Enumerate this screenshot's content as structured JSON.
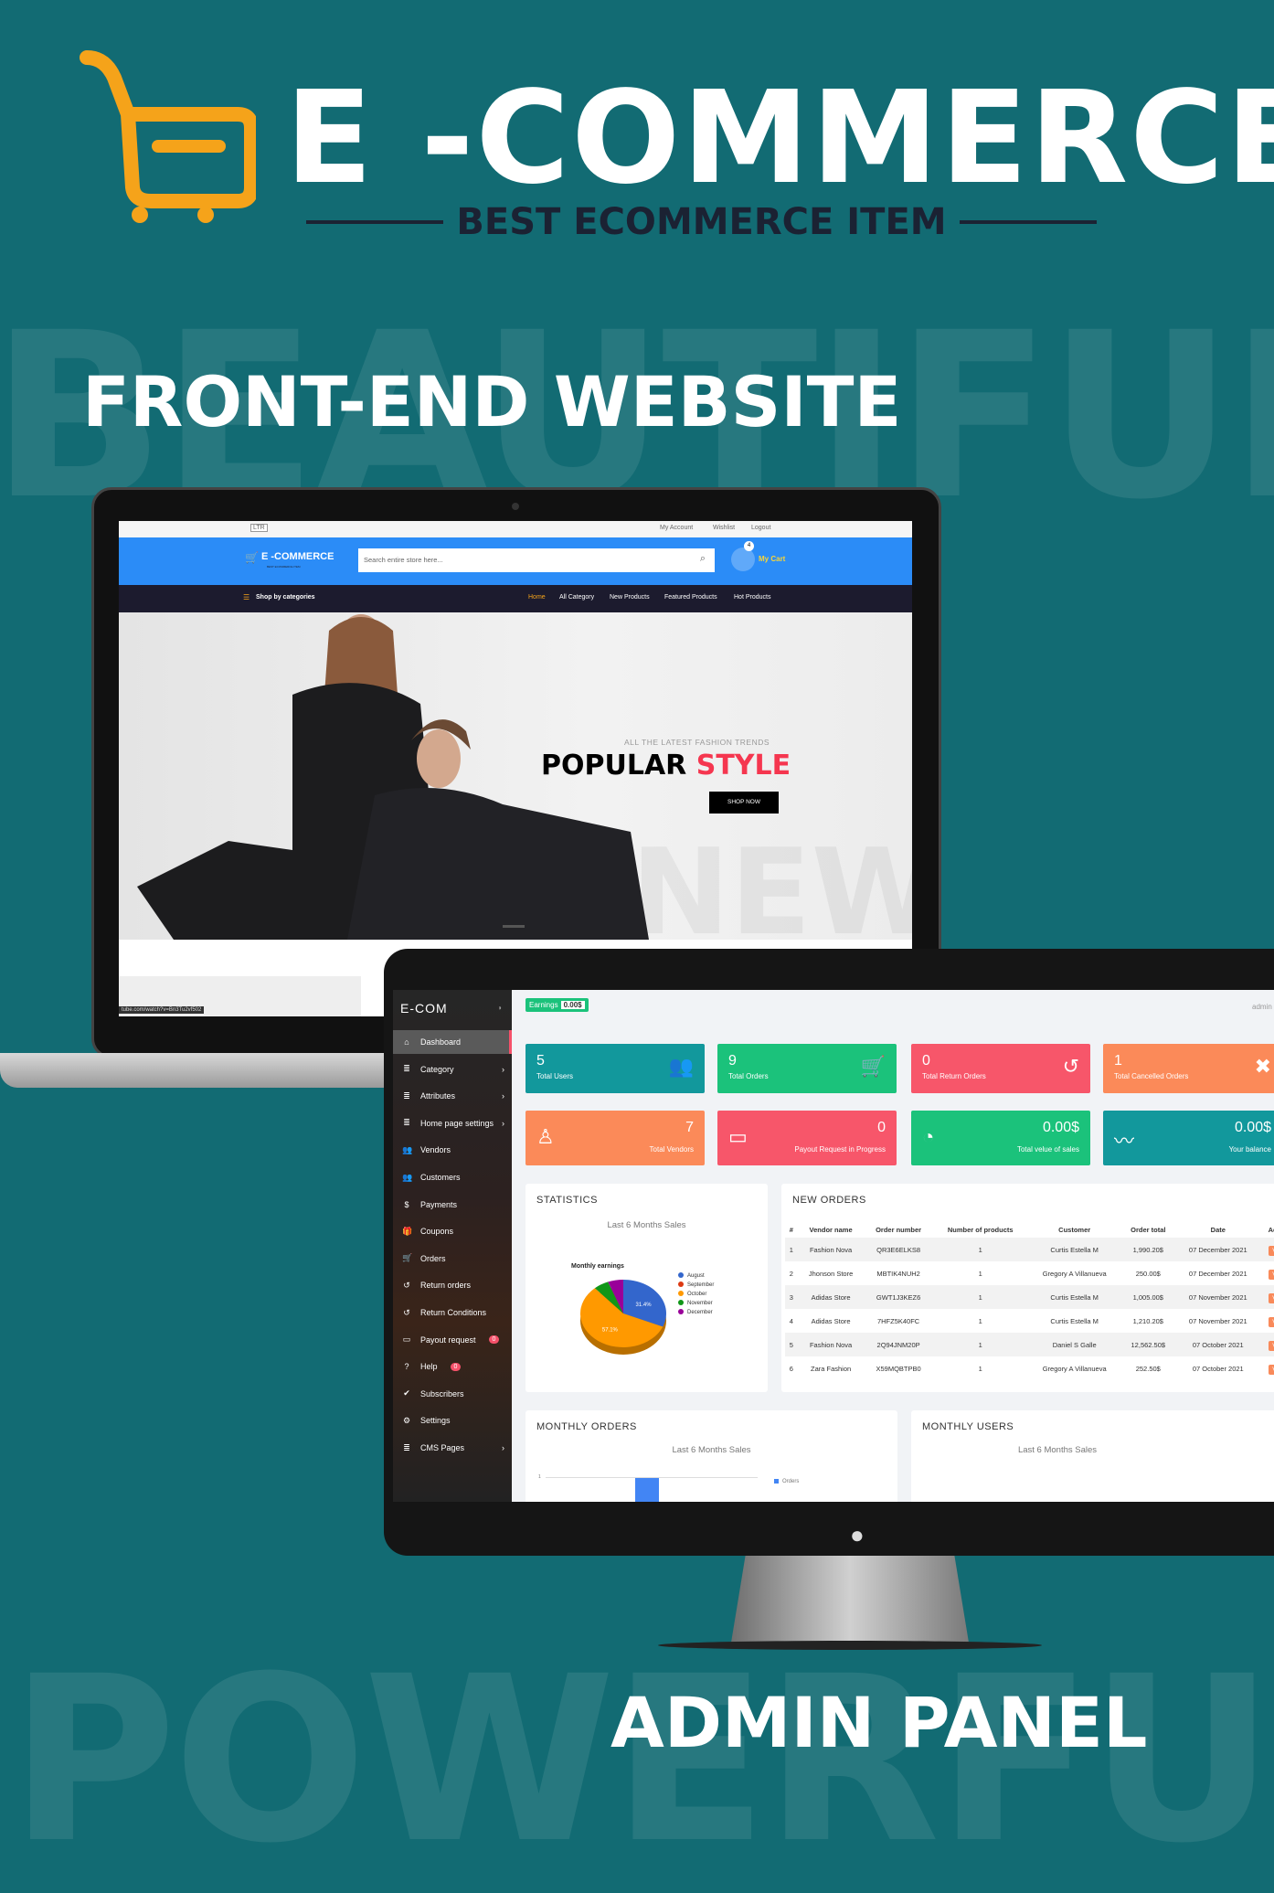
{
  "banner": {
    "title": "E -COMMERCE",
    "subtitle": "BEST ECOMMERCE ITEM",
    "watermark_top": "BEAUTIFUL",
    "watermark_bottom": "POWERFUL",
    "front_heading": "FRONT-END WEBSITE",
    "admin_heading": "ADMIN PANEL",
    "colors": {
      "background": "#126b73",
      "logo": "#f5a31a",
      "subtitle": "#1b2233"
    }
  },
  "storefront": {
    "direction_select": "LTR",
    "top_links": [
      "My Account",
      "Wishlist",
      "Logout"
    ],
    "logo_text": "E -COMMERCE",
    "logo_sub": "BEST ECOMMERCE ITEM",
    "search_placeholder": "Search entire store here...",
    "cart_count": "4",
    "cart_label": "My Cart",
    "categories_label": "Shop by categories",
    "nav": [
      "Home",
      "All Category",
      "New Products",
      "Featured Products",
      "Hot Products"
    ],
    "hero": {
      "kicker": "ALL THE LATEST FASHION TRENDS",
      "title_a": "POPULAR",
      "title_b": "STYLE",
      "button": "SHOP NOW",
      "watermark": "NEW"
    },
    "status_url": "tube.com/watch?v=Bn3Tu2vf502",
    "colors": {
      "header": "#2b8cf7",
      "nav": "#1c1b2e",
      "accent": "#f5364f"
    }
  },
  "admin": {
    "brand": "E-COM",
    "earnings_label": "Earnings",
    "earnings_value": "0.00$",
    "user": "admin",
    "sidebar": [
      {
        "label": "Dashboard",
        "icon": "home-icon",
        "active": true
      },
      {
        "label": "Category",
        "icon": "list-icon",
        "arrow": true
      },
      {
        "label": "Attributes",
        "icon": "list-icon",
        "arrow": true
      },
      {
        "label": "Home page settings",
        "icon": "list-icon",
        "arrow": true
      },
      {
        "label": "Vendors",
        "icon": "users-icon"
      },
      {
        "label": "Customers",
        "icon": "users-icon"
      },
      {
        "label": "Payments",
        "icon": "dollar-icon"
      },
      {
        "label": "Coupons",
        "icon": "gift-icon"
      },
      {
        "label": "Orders",
        "icon": "cart-icon"
      },
      {
        "label": "Return orders",
        "icon": "undo-icon"
      },
      {
        "label": "Return Conditions",
        "icon": "undo-icon"
      },
      {
        "label": "Payout request",
        "icon": "card-icon",
        "badge": "0"
      },
      {
        "label": "Help",
        "icon": "question-icon",
        "badge": "0"
      },
      {
        "label": "Subscribers",
        "icon": "check-icon"
      },
      {
        "label": "Settings",
        "icon": "gear-icon"
      },
      {
        "label": "CMS Pages",
        "icon": "list-icon",
        "arrow": true
      }
    ],
    "cards": [
      {
        "value": "5",
        "label": "Total Users",
        "icon": "users-icon",
        "color": "#12989c"
      },
      {
        "value": "9",
        "label": "Total Orders",
        "icon": "cart-icon",
        "color": "#1bc27b"
      },
      {
        "value": "0",
        "label": "Total Return Orders",
        "icon": "undo-icon",
        "color": "#f7566a"
      },
      {
        "value": "1",
        "label": "Total Cancelled Orders",
        "icon": "close-icon",
        "color": "#fb8a59"
      },
      {
        "value": "7",
        "label": "Total Vendors",
        "icon": "user-outline-icon",
        "color": "#fb8a59"
      },
      {
        "value": "0",
        "label": "Payout Request in Progress",
        "icon": "wallet-icon",
        "color": "#f7566a"
      },
      {
        "value": "0.00$",
        "label": "Total velue of sales",
        "icon": "pie-icon",
        "color": "#1bc27b"
      },
      {
        "value": "0.00$",
        "label": "Your balance",
        "icon": "trend-icon",
        "color": "#12989c"
      }
    ],
    "statistics": {
      "title": "STATISTICS",
      "subtitle": "Last 6 Months Sales"
    },
    "new_orders": {
      "title": "NEW ORDERS",
      "columns": [
        "#",
        "Vendor name",
        "Order number",
        "Number of products",
        "Customer",
        "Order total",
        "Date",
        "Action"
      ],
      "rows": [
        [
          "1",
          "Fashion Nova",
          "QR3E6ELKS8",
          "1",
          "Curtis Estella M",
          "1,990.20$",
          "07 December 2021",
          "View"
        ],
        [
          "2",
          "Jhonson Store",
          "MBTIK4NUH2",
          "1",
          "Gregory A Villanueva",
          "250.00$",
          "07 December 2021",
          "View"
        ],
        [
          "3",
          "Adidas Store",
          "GWT1J3KEZ6",
          "1",
          "Curtis Estella M",
          "1,005.00$",
          "07 November 2021",
          "View"
        ],
        [
          "4",
          "Adidas Store",
          "7HFZ5K40FC",
          "1",
          "Curtis Estella M",
          "1,210.20$",
          "07 November 2021",
          "View"
        ],
        [
          "5",
          "Fashion Nova",
          "2Q94JNM20P",
          "1",
          "Daniel S Galle",
          "12,562.50$",
          "07 October 2021",
          "View"
        ],
        [
          "6",
          "Zara Fashion",
          "X59MQBTPB0",
          "1",
          "Gregory A Villanueva",
          "252.50$",
          "07 October 2021",
          "View"
        ]
      ]
    },
    "monthly_orders": {
      "title": "MONTHLY ORDERS",
      "subtitle": "Last 6 Months Sales",
      "legend": "Orders",
      "tick": "1"
    },
    "monthly_users": {
      "title": "MONTHLY USERS",
      "subtitle": "Last 6 Months Sales"
    }
  },
  "chart_data": {
    "type": "pie",
    "title": "Monthly earnings",
    "categories": [
      "August",
      "September",
      "October",
      "November",
      "December"
    ],
    "values": [
      31.4,
      0,
      57.1,
      5.7,
      5.8
    ],
    "colors": [
      "#3366cc",
      "#dc3912",
      "#ff9900",
      "#109618",
      "#990099"
    ],
    "data_labels": [
      "31.4%",
      "",
      "57.1%",
      "",
      ""
    ],
    "legend": "right"
  }
}
